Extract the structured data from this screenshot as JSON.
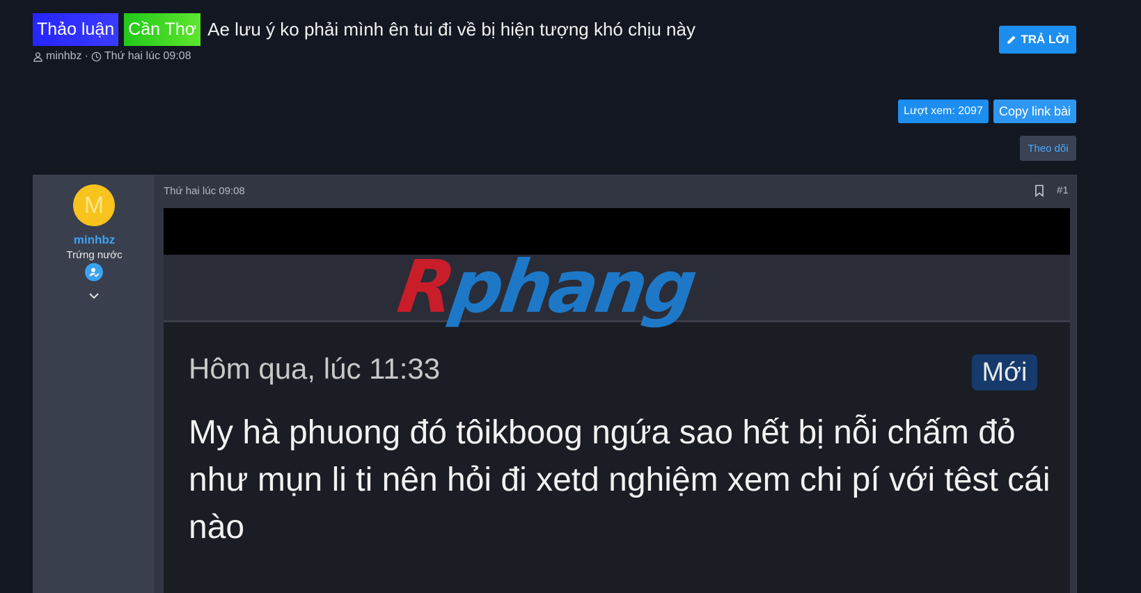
{
  "thread": {
    "prefix_1": "Thảo luận",
    "prefix_2": "Cần Thơ",
    "title": "Ae lưu ý ko phải mình ên tui đi về bị hiện tượng khó chịu này",
    "author": "minhbz",
    "separator": "·",
    "date": "Thứ hai lúc 09:08"
  },
  "actions": {
    "reply_label": "TRẢ LỜI",
    "views_label": "Lượt xem: 2097",
    "copy_link_label": "Copy link bài",
    "follow_label": "Theo dõi"
  },
  "post": {
    "avatar_letter": "M",
    "username": "minhbz",
    "user_title": "Trứng nước",
    "date": "Thứ hai lúc 09:08",
    "number": "#1",
    "attachment": {
      "logo_r": "R",
      "logo_rest": "phang",
      "time": "Hôm qua, lúc 11:33",
      "badge": "Mới",
      "body": "My hà phuong đó tôikboog ngứa sao hết bị nỗi chấm đỏ như mụn li ti nên hỏi đi xetd nghiệm xem chi pí với têst cái nào"
    }
  },
  "colors": {
    "background": "#131722",
    "accent": "#1c8ef0",
    "username": "#3ea2f5",
    "prefix_blue": "#2525ff",
    "prefix_green": "#22c81a",
    "avatar": "#f7c31c"
  },
  "icons": {
    "author": "user-icon",
    "date": "clock-icon",
    "reply": "pencil-icon",
    "badge": "user-check-icon",
    "expand": "chevron-down-icon",
    "bookmark": "bookmark-icon"
  }
}
